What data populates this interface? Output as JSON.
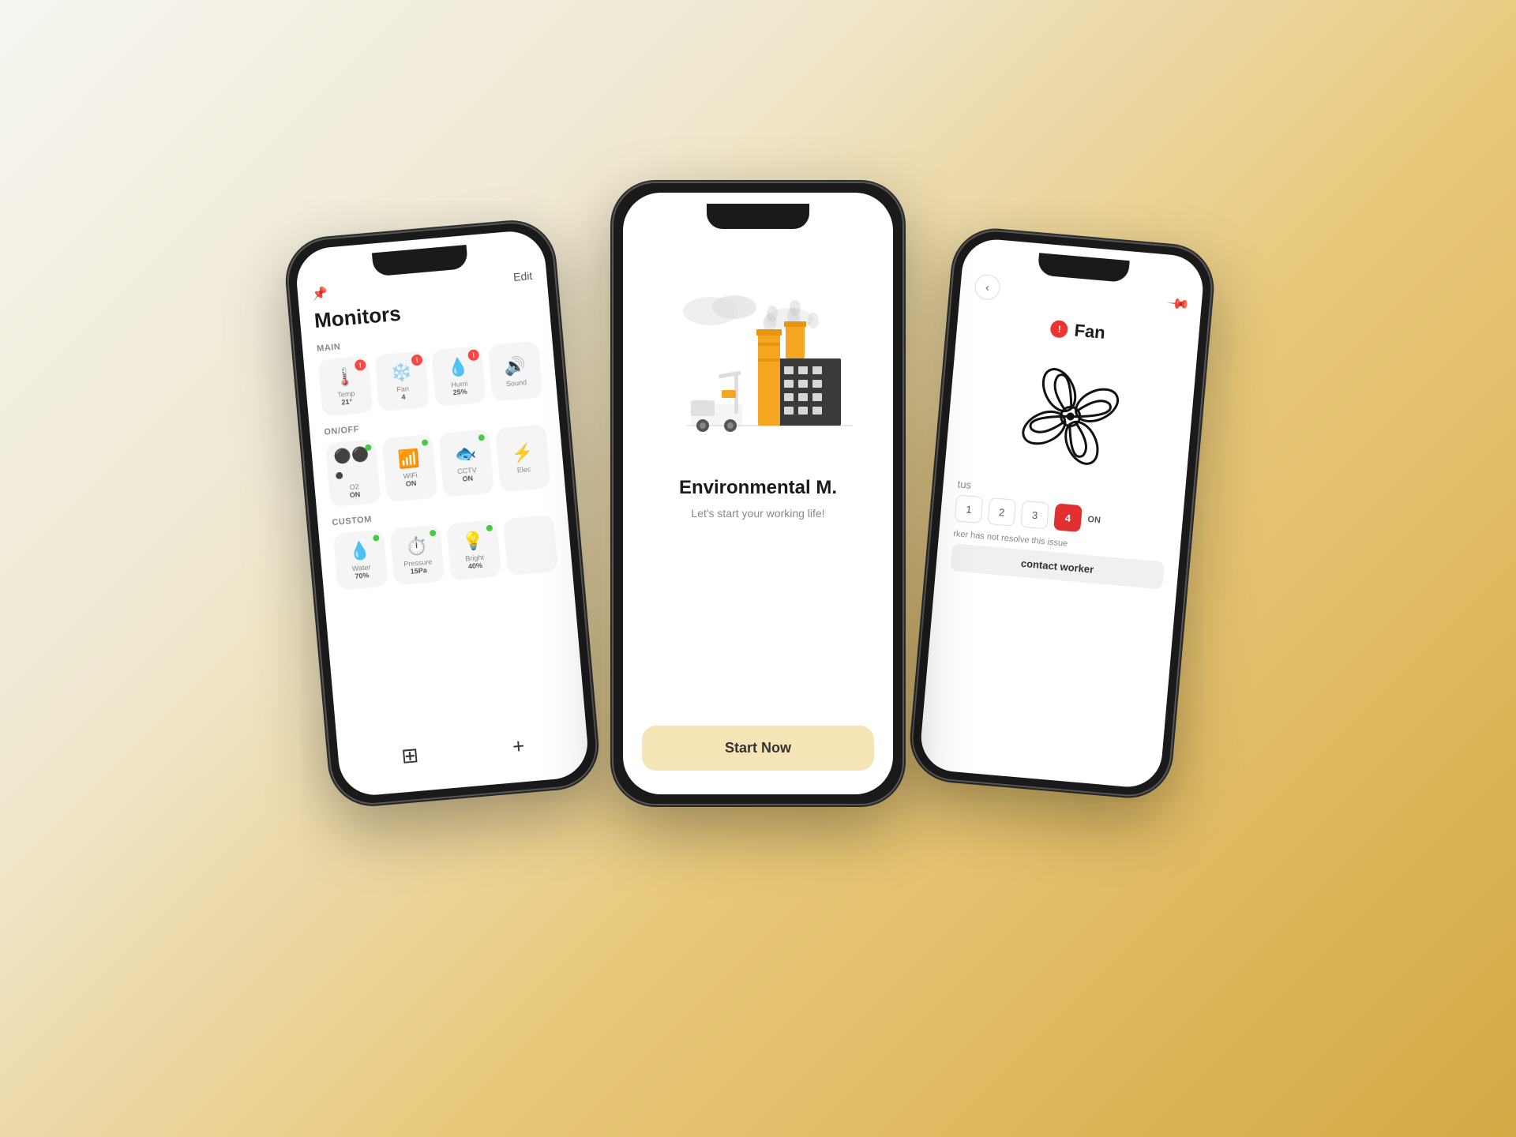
{
  "background": {
    "gradient_start": "#f5f5f0",
    "gradient_end": "#d4a843"
  },
  "phones": {
    "left": {
      "title": "Monitors",
      "edit_label": "Edit",
      "sections": {
        "main": {
          "label": "MAIN",
          "cards": [
            {
              "icon": "🌡️",
              "label": "Temp",
              "value": "21°",
              "alert": true
            },
            {
              "icon": "❄️",
              "label": "Fan",
              "value": "4",
              "alert": true
            },
            {
              "icon": "💧",
              "label": "Humi",
              "value": "25%",
              "alert": false
            },
            {
              "icon": "🔊",
              "label": "Sound",
              "value": "",
              "alert": false
            }
          ]
        },
        "onoff": {
          "label": "ON/OFF",
          "cards": [
            {
              "icon": "⚫",
              "label": "O2",
              "value": "ON",
              "online": true
            },
            {
              "icon": "📶",
              "label": "WiFi",
              "value": "ON",
              "online": true
            },
            {
              "icon": "📷",
              "label": "CCTV",
              "value": "ON",
              "online": true
            },
            {
              "icon": "⚡",
              "label": "Elec",
              "value": "",
              "online": false
            }
          ]
        },
        "custom": {
          "label": "CUSTOM",
          "cards": [
            {
              "icon": "💧",
              "label": "Water",
              "value": "70%",
              "online": true
            },
            {
              "icon": "⏱️",
              "label": "Pressure",
              "value": "15Pa",
              "online": true
            },
            {
              "icon": "💡",
              "label": "Bright",
              "value": "40%",
              "online": true
            },
            {
              "icon": "",
              "label": "",
              "value": "",
              "online": false
            }
          ]
        }
      },
      "nav": {
        "grid_icon": "⊞",
        "add_icon": "+"
      }
    },
    "center": {
      "title": "Environmental M.",
      "subtitle": "Let's start your working life!",
      "start_button": "Start Now"
    },
    "right": {
      "page_title": "Fan",
      "alert_symbol": "!",
      "status_label": "tus",
      "speed_levels": [
        "1",
        "2",
        "3",
        "4",
        "ON"
      ],
      "active_speed": "4",
      "worker_message": "rker has not resolve this issue",
      "contact_button": "contact worker"
    }
  }
}
